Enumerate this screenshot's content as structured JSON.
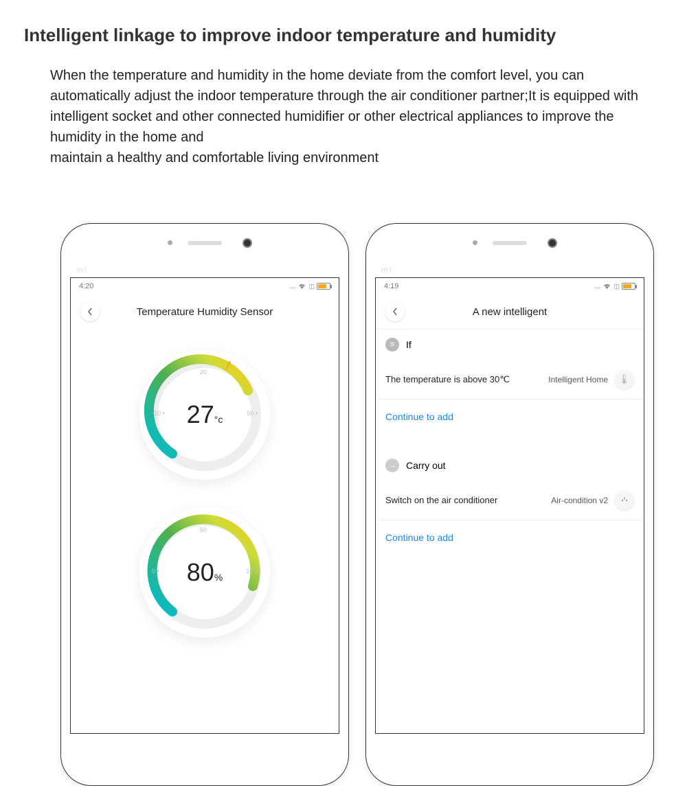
{
  "title": "Intelligent linkage to improve indoor temperature and humidity",
  "description": "When the temperature and humidity in the home deviate from the comfort level, you can automatically adjust the indoor temperature through the air conditioner partner;It is equipped with intelligent socket and other connected humidifier or other electrical appliances to improve the humidity in the home and\n maintain a healthy and comfortable living environment",
  "left": {
    "time": "4:20",
    "dots": "...",
    "brand": "mi",
    "header": "Temperature Humidity Sensor",
    "temp_value": "27",
    "temp_unit": "°c",
    "temp_min": "-10 •",
    "temp_mid": "20",
    "temp_max": "50 •",
    "hum_value": "80",
    "hum_unit": "%",
    "hum_min": "0 •",
    "hum_mid": "50",
    "hum_max": "100 •"
  },
  "right": {
    "time": "4:19",
    "dots": "...",
    "brand": "mi",
    "header": "A new intelligent",
    "if_label": "If",
    "if_icon": "≡",
    "rule1_text": "The temperature is above 30℃",
    "rule1_device": "Intelligent Home",
    "add1": "Continue to add",
    "carry_label": "Carry out",
    "carry_icon": "→",
    "rule2_text": "Switch on the air conditioner",
    "rule2_device": "Air-condition v2",
    "add2": "Continue to add",
    "sensor_glyph": "🌡",
    "plug_glyph": "⚡"
  }
}
